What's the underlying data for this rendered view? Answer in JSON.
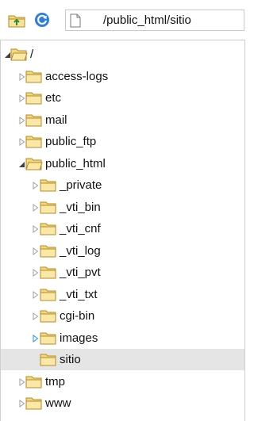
{
  "toolbar": {
    "up_icon": "folder-up-icon",
    "refresh_icon": "refresh-icon",
    "path_icon": "document-icon",
    "path": "/public_html/sitio"
  },
  "colors": {
    "folder_body": "#f3d97c",
    "folder_edge": "#b58a2a",
    "arrow_collapsed": "#a0a0a0",
    "arrow_hover": "#1e90ff",
    "selected_row": "#e5e5e5"
  },
  "tree": {
    "root": {
      "label": "/",
      "state": "expanded"
    },
    "items": [
      {
        "label": "access-logs",
        "state": "collapsed"
      },
      {
        "label": "etc",
        "state": "collapsed"
      },
      {
        "label": "mail",
        "state": "collapsed"
      },
      {
        "label": "public_ftp",
        "state": "collapsed"
      },
      {
        "label": "public_html",
        "state": "expanded"
      },
      {
        "label": "_private",
        "state": "collapsed"
      },
      {
        "label": "_vti_bin",
        "state": "collapsed"
      },
      {
        "label": "_vti_cnf",
        "state": "collapsed"
      },
      {
        "label": "_vti_log",
        "state": "collapsed"
      },
      {
        "label": "_vti_pvt",
        "state": "collapsed"
      },
      {
        "label": "_vti_txt",
        "state": "collapsed"
      },
      {
        "label": "cgi-bin",
        "state": "collapsed"
      },
      {
        "label": "images",
        "state": "collapsed"
      },
      {
        "label": "sitio",
        "state": "none",
        "selected": true
      },
      {
        "label": "tmp",
        "state": "collapsed"
      },
      {
        "label": "www",
        "state": "collapsed"
      }
    ]
  }
}
